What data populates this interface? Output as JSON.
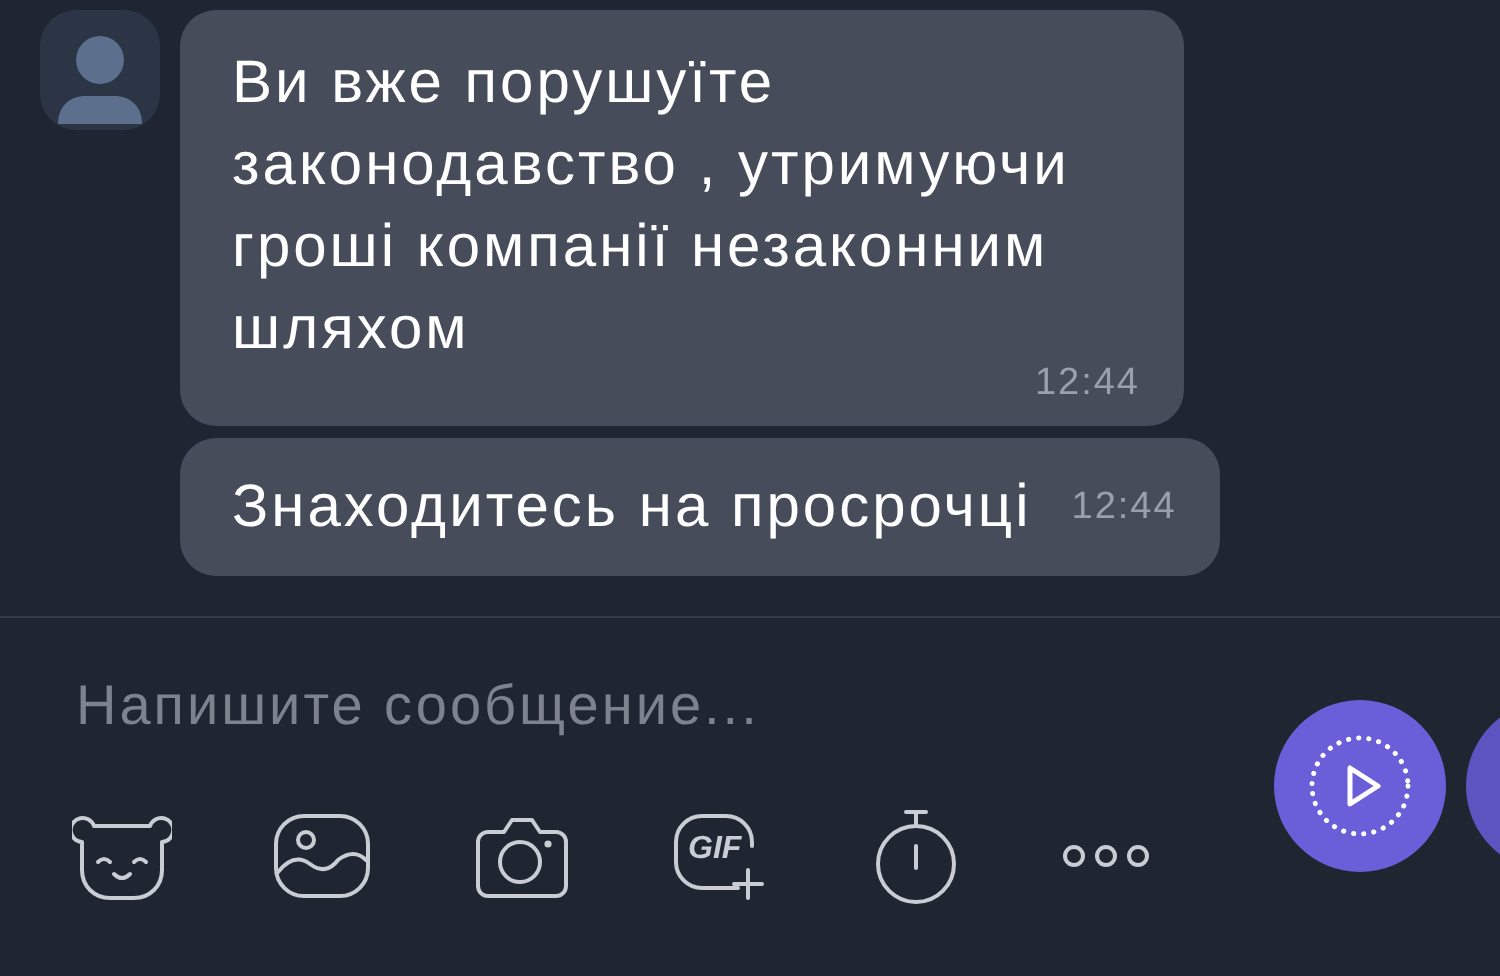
{
  "messages": [
    {
      "text": "Ви вже порушуїте законодавство , утримуючи гроші компанії незаконним шляхом",
      "time": "12:44",
      "show_avatar": true
    },
    {
      "text": "Знаходитесь на просрочці",
      "time": "12:44",
      "show_avatar": false
    }
  ],
  "composer": {
    "placeholder": "Напишите сообщение..."
  },
  "toolbar": [
    {
      "kind": "sticker"
    },
    {
      "kind": "gallery"
    },
    {
      "kind": "camera"
    },
    {
      "kind": "gif",
      "label": "GIF"
    },
    {
      "kind": "timer"
    },
    {
      "kind": "more"
    }
  ]
}
